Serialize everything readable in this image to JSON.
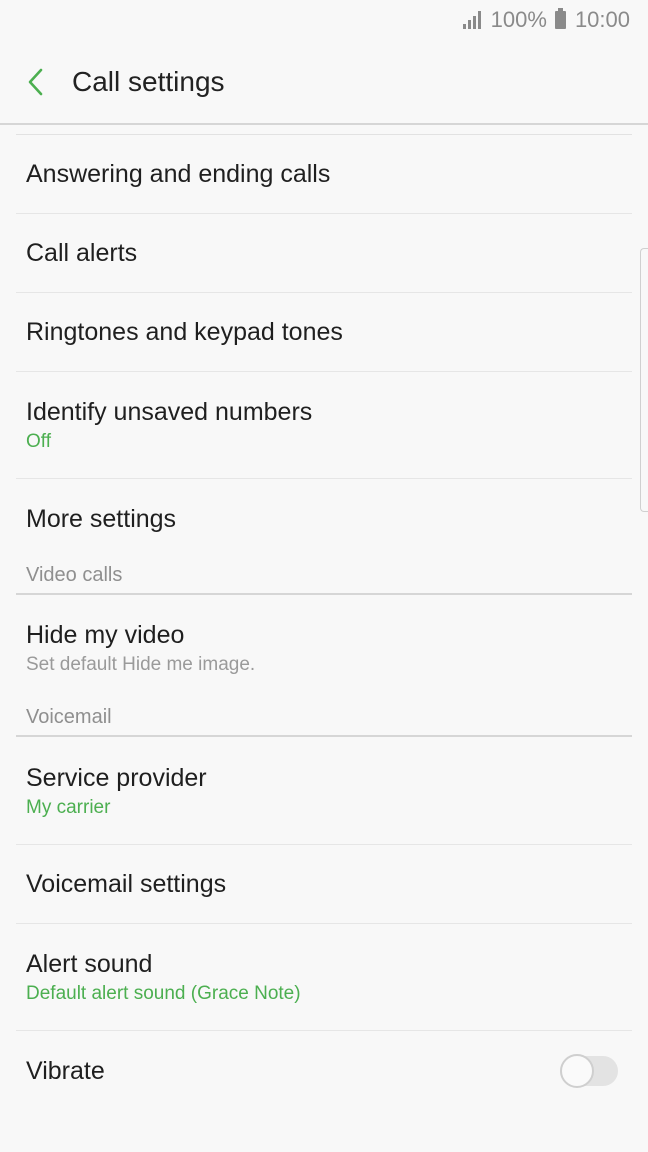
{
  "status_bar": {
    "battery_percent": "100%",
    "time": "10:00"
  },
  "header": {
    "title": "Call settings"
  },
  "items": [
    {
      "title": "Answering and ending calls"
    },
    {
      "title": "Call alerts"
    },
    {
      "title": "Ringtones and keypad tones"
    },
    {
      "title": "Identify unsaved numbers",
      "subtitle": "Off"
    },
    {
      "title": "More settings"
    }
  ],
  "video_calls": {
    "header": "Video calls",
    "hide_video": {
      "title": "Hide my video",
      "subtitle": "Set default Hide me image."
    }
  },
  "voicemail": {
    "header": "Voicemail",
    "service_provider": {
      "title": "Service provider",
      "subtitle": "My carrier"
    },
    "voicemail_settings": {
      "title": "Voicemail settings"
    },
    "alert_sound": {
      "title": "Alert sound",
      "subtitle": "Default alert sound (Grace Note)"
    },
    "vibrate": {
      "title": "Vibrate",
      "enabled": false
    }
  },
  "colors": {
    "accent": "#4caf50",
    "background": "#f8f8f8"
  }
}
